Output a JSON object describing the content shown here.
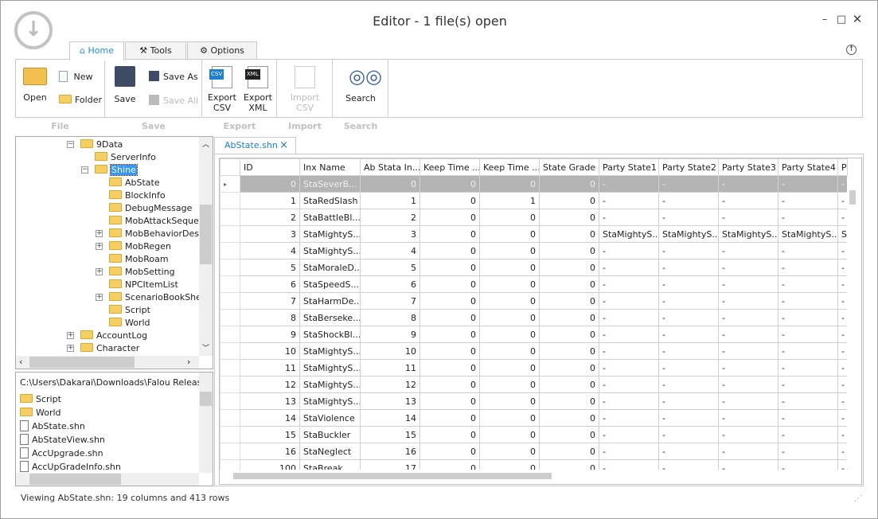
{
  "window": {
    "title": "Editor - 1 file(s) open",
    "controls": [
      "minimize",
      "maximize",
      "close"
    ]
  },
  "app_button": {
    "icon": "download-circle-icon"
  },
  "tabs": [
    {
      "label": "Home",
      "icon": "home-icon",
      "active": true
    },
    {
      "label": "Tools",
      "icon": "tools-icon"
    },
    {
      "label": "Options",
      "icon": "gear-icon"
    }
  ],
  "ribbon": {
    "groups": {
      "file": "File",
      "save": "Save",
      "export": "Export",
      "import": "Import",
      "search": "Search"
    },
    "open": "Open",
    "new": "New",
    "folder": "Folder",
    "save": "Save",
    "save_as": "Save As",
    "save_all": "Save All",
    "export_csv": "Export CSV",
    "export_xml": "Export XML",
    "import_csv": "Import CSV",
    "search": "Search",
    "csv_badge": "CSV",
    "xml_badge": "XML"
  },
  "tree": {
    "items": [
      {
        "label": "9Data",
        "level": 0,
        "expander": "-"
      },
      {
        "label": "ServerInfo",
        "level": 1,
        "expander": ""
      },
      {
        "label": "Shine",
        "level": 1,
        "expander": "-",
        "selected": true
      },
      {
        "label": "AbState",
        "level": 2,
        "expander": ""
      },
      {
        "label": "BlockInfo",
        "level": 2,
        "expander": ""
      },
      {
        "label": "DebugMessage",
        "level": 2,
        "expander": ""
      },
      {
        "label": "MobAttackSequence",
        "level": 2,
        "expander": ""
      },
      {
        "label": "MobBehaviorDescription",
        "level": 2,
        "expander": "+"
      },
      {
        "label": "MobRegen",
        "level": 2,
        "expander": "+"
      },
      {
        "label": "MobRoam",
        "level": 2,
        "expander": ""
      },
      {
        "label": "MobSetting",
        "level": 2,
        "expander": "+"
      },
      {
        "label": "NPCItemList",
        "level": 2,
        "expander": ""
      },
      {
        "label": "ScenarioBookShelf",
        "level": 2,
        "expander": "+"
      },
      {
        "label": "Script",
        "level": 2,
        "expander": ""
      },
      {
        "label": "World",
        "level": 2,
        "expander": ""
      },
      {
        "label": "AccountLog",
        "level": 0,
        "expander": "+"
      },
      {
        "label": "Character",
        "level": 0,
        "expander": "+"
      }
    ]
  },
  "browser": {
    "path": "C:\\Users\\Dakarai\\Downloads\\Falou Release\\Fa",
    "items": [
      {
        "label": "Script",
        "type": "folder"
      },
      {
        "label": "World",
        "type": "folder"
      },
      {
        "label": "AbState.shn",
        "type": "file"
      },
      {
        "label": "AbStateView.shn",
        "type": "file"
      },
      {
        "label": "AccUpgrade.shn",
        "type": "file"
      },
      {
        "label": "AccUpGradeInfo.shn",
        "type": "file"
      }
    ]
  },
  "doc_tab": {
    "label": "AbState.shn",
    "close": "×"
  },
  "grid": {
    "columns": [
      "ID",
      "Inx Name",
      "Ab Stata In...",
      "Keep Time ...",
      "Keep Time ...",
      "State Grade",
      "Party State1",
      "Party State2",
      "Party State3",
      "Party State4",
      "Party"
    ],
    "rows": [
      [
        "0",
        "StaSeverB...",
        "0",
        "0",
        "0",
        "0",
        "-",
        "-",
        "-",
        "-",
        "-"
      ],
      [
        "1",
        "StaRedSlash",
        "1",
        "0",
        "1",
        "0",
        "-",
        "-",
        "-",
        "-",
        "-"
      ],
      [
        "2",
        "StaBattleBl...",
        "2",
        "0",
        "0",
        "0",
        "-",
        "-",
        "-",
        "-",
        "-"
      ],
      [
        "3",
        "StaMightyS...",
        "3",
        "0",
        "0",
        "0",
        "StaMightyS...",
        "StaMightyS...",
        "StaMightyS...",
        "StaMightyS...",
        "S"
      ],
      [
        "4",
        "StaMightyS...",
        "4",
        "0",
        "0",
        "0",
        "-",
        "-",
        "-",
        "-",
        "-"
      ],
      [
        "5",
        "StaMoraleD...",
        "5",
        "0",
        "0",
        "0",
        "-",
        "-",
        "-",
        "-",
        "-"
      ],
      [
        "6",
        "StaSpeedS...",
        "6",
        "0",
        "0",
        "0",
        "-",
        "-",
        "-",
        "-",
        "-"
      ],
      [
        "7",
        "StaHarmDe...",
        "7",
        "0",
        "0",
        "0",
        "-",
        "-",
        "-",
        "-",
        "-"
      ],
      [
        "8",
        "StaBerseke...",
        "8",
        "0",
        "0",
        "0",
        "-",
        "-",
        "-",
        "-",
        "-"
      ],
      [
        "9",
        "StaShockBl...",
        "9",
        "0",
        "0",
        "0",
        "-",
        "-",
        "-",
        "-",
        "-"
      ],
      [
        "10",
        "StaMightyS...",
        "10",
        "0",
        "0",
        "0",
        "-",
        "-",
        "-",
        "-",
        "-"
      ],
      [
        "11",
        "StaMightyS...",
        "11",
        "0",
        "0",
        "0",
        "-",
        "-",
        "-",
        "-",
        "-"
      ],
      [
        "12",
        "StaMightyS...",
        "12",
        "0",
        "0",
        "0",
        "-",
        "-",
        "-",
        "-",
        "-"
      ],
      [
        "13",
        "StaMightyS...",
        "13",
        "0",
        "0",
        "0",
        "-",
        "-",
        "-",
        "-",
        "-"
      ],
      [
        "14",
        "StaViolence",
        "14",
        "0",
        "0",
        "0",
        "-",
        "-",
        "-",
        "-",
        "-"
      ],
      [
        "15",
        "StaBuckler",
        "15",
        "0",
        "0",
        "0",
        "-",
        "-",
        "-",
        "-",
        "-"
      ],
      [
        "16",
        "StaNeglect",
        "16",
        "0",
        "0",
        "0",
        "-",
        "-",
        "-",
        "-",
        "-"
      ],
      [
        "100",
        "StaBreak",
        "17",
        "0",
        "0",
        "0",
        "-",
        "-",
        "-",
        "-",
        "-"
      ]
    ],
    "selected_row": 0
  },
  "status": {
    "text": "Viewing AbState.shn: 19 columns and 413 rows"
  }
}
